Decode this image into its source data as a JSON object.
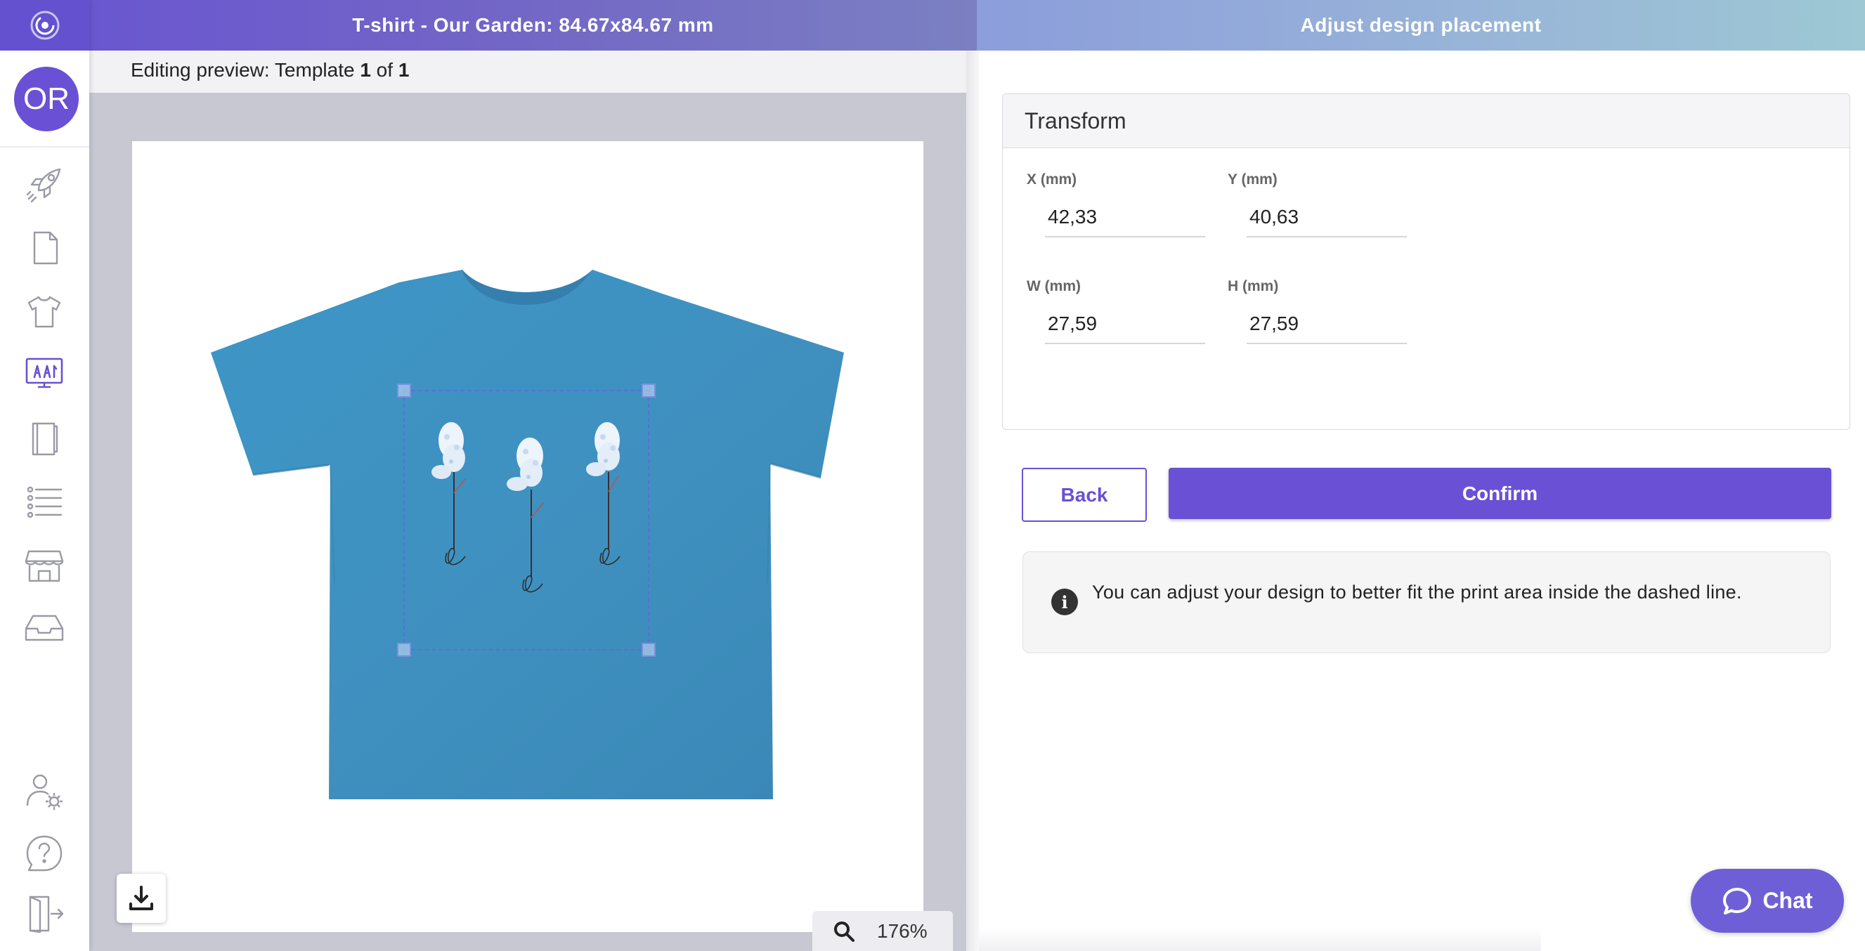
{
  "header": {
    "title": "T-shirt - Our Garden: 84.67x84.67 mm",
    "panel_title": "Adjust design placement"
  },
  "sidebar": {
    "avatar_initials": "OR",
    "items": [
      {
        "icon": "rocket-icon"
      },
      {
        "icon": "document-icon"
      },
      {
        "icon": "tshirt-icon"
      },
      {
        "icon": "design-monitor-icon",
        "active": true
      },
      {
        "icon": "notebook-icon"
      },
      {
        "icon": "list-icon"
      },
      {
        "icon": "store-icon"
      },
      {
        "icon": "inbox-icon"
      },
      {
        "icon": "user-settings-icon"
      },
      {
        "icon": "help-icon"
      },
      {
        "icon": "logout-icon"
      }
    ]
  },
  "editor": {
    "preview_prefix": "Editing preview: Template ",
    "preview_current": "1",
    "preview_of": " of ",
    "preview_total": "1",
    "zoom": "176%",
    "shirt_color": "#3f93c2"
  },
  "transform": {
    "title": "Transform",
    "x_label": "X (mm)",
    "x_value": "42,33",
    "y_label": "Y (mm)",
    "y_value": "40,63",
    "w_label": "W (mm)",
    "w_value": "27,59",
    "h_label": "H (mm)",
    "h_value": "27,59"
  },
  "actions": {
    "back_label": "Back",
    "confirm_label": "Confirm"
  },
  "info": {
    "text": "You can adjust your design to better fit the print area inside the dashed line."
  },
  "chat": {
    "label": "Chat"
  },
  "colors": {
    "brand": "#6a50d4",
    "tshirt": "#3f93c2"
  }
}
